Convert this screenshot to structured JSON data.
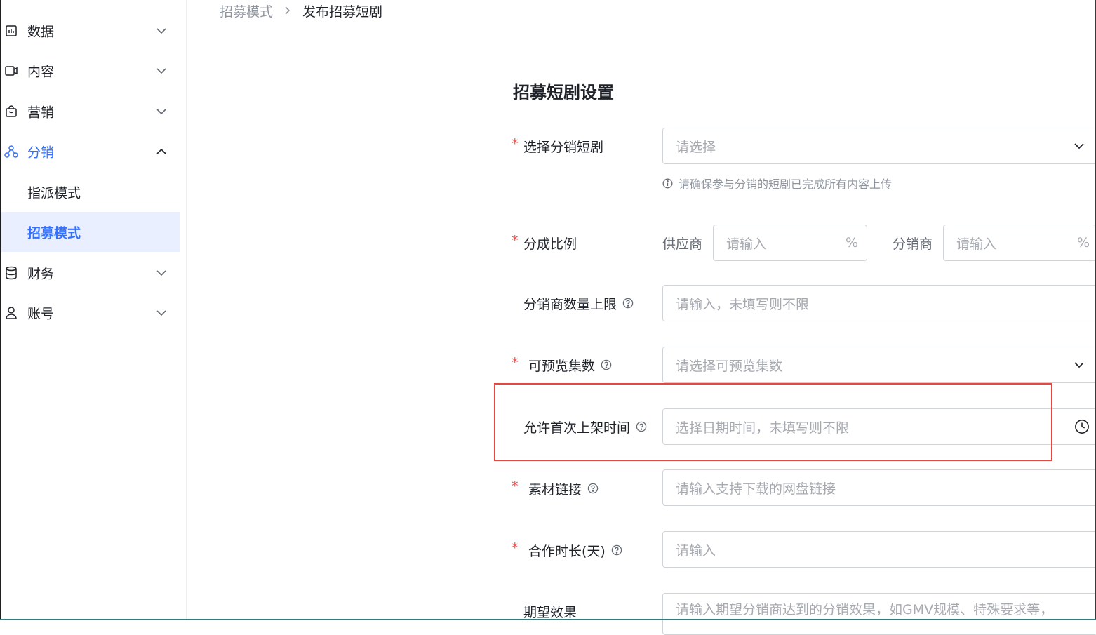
{
  "sidebar": {
    "items": [
      {
        "label": "数据",
        "icon": "bar-chart-icon"
      },
      {
        "label": "内容",
        "icon": "video-icon"
      },
      {
        "label": "营销",
        "icon": "shopping-bag-icon"
      },
      {
        "label": "分销",
        "icon": "distribution-icon"
      },
      {
        "label": "财务",
        "icon": "database-icon"
      },
      {
        "label": "账号",
        "icon": "user-icon"
      }
    ],
    "sub_items": [
      {
        "label": "指派模式"
      },
      {
        "label": "招募模式"
      }
    ],
    "active_color": "#3370ff",
    "selected_bg": "#e9efff"
  },
  "breadcrumb": {
    "parent": "招募模式",
    "current": "发布招募短剧"
  },
  "form": {
    "title": "招募短剧设置",
    "required_mark": "*",
    "select_drama": {
      "label": "选择分销短剧",
      "placeholder": "请选择",
      "hint": "请确保参与分销的短剧已完成所有内容上传"
    },
    "split_ratio": {
      "label": "分成比例",
      "supplier_label": "供应商",
      "supplier_placeholder": "请输入",
      "distributor_label": "分销商",
      "distributor_placeholder": "请输入",
      "unit": "%"
    },
    "distributor_limit": {
      "label": "分销商数量上限",
      "placeholder": "请输入，未填写则不限"
    },
    "preview_episodes": {
      "label": "可预览集数",
      "placeholder": "请选择可预览集数"
    },
    "first_release_time": {
      "label": "允许首次上架时间",
      "placeholder": "选择日期时间，未填写则不限"
    },
    "material_link": {
      "label": "素材链接",
      "placeholder": "请输入支持下载的网盘链接"
    },
    "cooperation_days": {
      "label": "合作时长(天)",
      "placeholder": "请输入"
    },
    "expected_effect": {
      "label": "期望效果",
      "placeholder": "请输入期望分销商达到的分销效果，如GMV规模、特殊要求等，"
    }
  },
  "colors": {
    "required": "#f54a45",
    "highlight": "#e5483f",
    "placeholder": "#a6aab0"
  }
}
